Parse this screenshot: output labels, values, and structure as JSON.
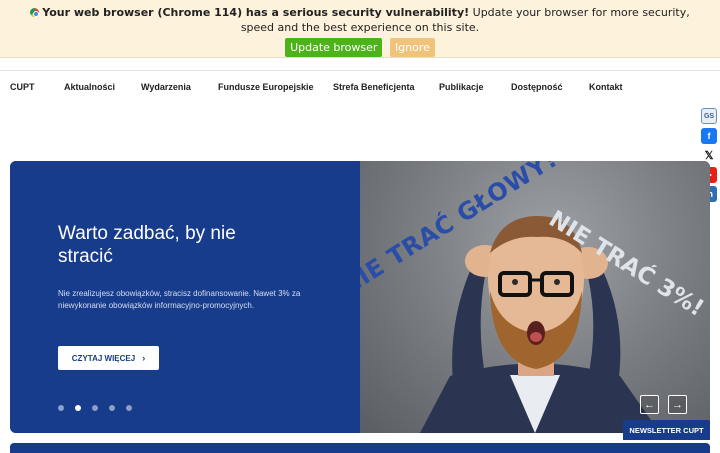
{
  "update_banner": {
    "warning_bold": "Your web browser (Chrome 114) has a serious security vulnerability!",
    "warning_rest": "Update your browser for more security, speed and the best experience on this site.",
    "update_label": "Update browser",
    "ignore_label": "Ignore"
  },
  "nav": {
    "items": [
      "CUPT",
      "Aktualności",
      "Wydarzenia",
      "Fundusze Europejskie",
      "Strefa Beneficjenta",
      "Publikacje",
      "Dostępność",
      "Kontakt"
    ]
  },
  "social": {
    "gs_label": "GS"
  },
  "hero": {
    "title": "Warto zadbać, by nie stracić",
    "text": "Nie zrealizujesz obowiązków, stracisz dofinansowanie. Nawet 3% za niewykonanie obowiązków informacyjno-promocyjnych.",
    "button_label": "CZYTAJ WIĘCEJ",
    "slide_count": 5,
    "active_slide": 2,
    "photo_slogan_left": "NIE TRAĆ GŁOWY!",
    "photo_slogan_right": "NIE TRAĆ 3%!"
  },
  "newsletter": {
    "label": "NEWSLETTER CUPT"
  },
  "colors": {
    "brand_blue": "#173c8c",
    "banner_bg": "#fdf2dc",
    "update_green": "#4eb31b",
    "ignore_orange": "#f1c27a"
  }
}
